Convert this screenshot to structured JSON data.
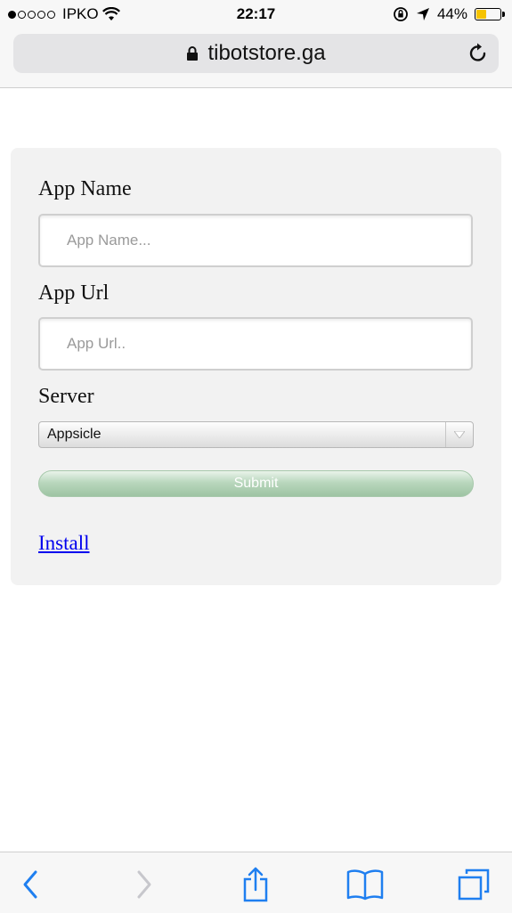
{
  "status_bar": {
    "carrier": "IPKO",
    "time": "22:17",
    "battery_text": "44%",
    "battery_level": 0.44,
    "battery_color": "#f6c300"
  },
  "browser": {
    "url": "tibotstore.ga",
    "icons": {
      "lock": "lock-icon",
      "reload": "reload-icon",
      "back": "back-icon",
      "forward": "forward-icon",
      "share": "share-icon",
      "bookmarks": "bookmarks-icon",
      "tabs": "tabs-icon"
    },
    "accent_color": "#1f7ff0"
  },
  "form": {
    "app_name_label": "App Name",
    "app_name_placeholder": "App Name...",
    "app_url_label": "App Url",
    "app_url_placeholder": "App Url..",
    "server_label": "Server",
    "server_selected": "Appsicle",
    "submit_label": "Submit",
    "install_link": "Install"
  }
}
